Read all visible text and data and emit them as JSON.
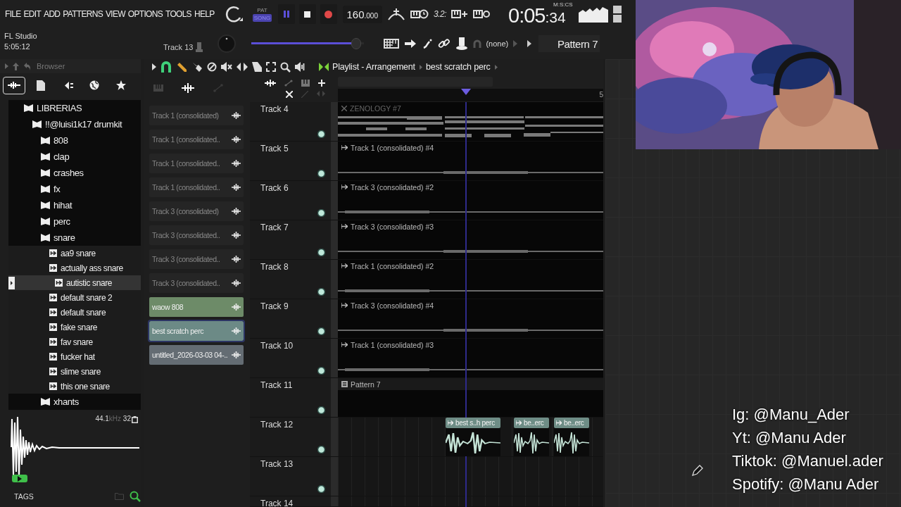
{
  "menu": [
    "FILE",
    "EDIT",
    "ADD",
    "PATTERNS",
    "VIEW",
    "OPTIONS",
    "TOOLS",
    "HELP"
  ],
  "mode_toggle": [
    {
      "label": "PAT",
      "selected": false
    },
    {
      "label": "SONG",
      "selected": true
    }
  ],
  "tempo": {
    "whole": "160",
    "fraction": ".000"
  },
  "snap_label": "3.2:",
  "time": {
    "main": "0:05",
    "sub": ":34",
    "unit": "M:S:CS"
  },
  "hint": {
    "app": "FL Studio",
    "time": "5:05:12"
  },
  "current_channel": "Track 13",
  "main_volume": {
    "level": 0.93
  },
  "mixer_target": "(none)",
  "pattern_name": "Pattern 7",
  "browser": {
    "title": "Browser",
    "tabs": [
      {
        "kind": "all",
        "selected": true
      },
      {
        "kind": "files",
        "selected": false
      },
      {
        "kind": "plugins",
        "selected": false
      },
      {
        "kind": "web",
        "selected": false
      },
      {
        "kind": "starred",
        "selected": false
      }
    ],
    "tree": [
      {
        "kind": "folder",
        "label": "LIBRERIAS",
        "selected": false,
        "children": [
          {
            "kind": "folder",
            "label": "!!@luisi1k17 drumkit",
            "selected": false,
            "children": [
              {
                "kind": "folder",
                "label": "808",
                "selected": false
              },
              {
                "kind": "folder",
                "label": "clap",
                "selected": false
              },
              {
                "kind": "folder",
                "label": "crashes",
                "selected": false
              },
              {
                "kind": "folder",
                "label": "fx",
                "selected": false
              },
              {
                "kind": "folder",
                "label": "hihat",
                "selected": false
              },
              {
                "kind": "folder",
                "label": "perc",
                "selected": false
              },
              {
                "kind": "folder",
                "label": "snare",
                "selected": false,
                "children": [
                  {
                    "kind": "file",
                    "label": "aa9 snare",
                    "selected": false
                  },
                  {
                    "kind": "file",
                    "label": "actually ass snare",
                    "selected": false
                  },
                  {
                    "kind": "file",
                    "label": "autistic snare",
                    "selected": true
                  },
                  {
                    "kind": "file",
                    "label": "default snare 2",
                    "selected": false
                  },
                  {
                    "kind": "file",
                    "label": "default snare",
                    "selected": false
                  },
                  {
                    "kind": "file",
                    "label": "fake snare",
                    "selected": false
                  },
                  {
                    "kind": "file",
                    "label": "fav snare",
                    "selected": false
                  },
                  {
                    "kind": "file",
                    "label": "fucker hat",
                    "selected": false
                  },
                  {
                    "kind": "file",
                    "label": "slime snare",
                    "selected": false
                  },
                  {
                    "kind": "file",
                    "label": "this one snare",
                    "selected": false
                  }
                ]
              },
              {
                "kind": "folder",
                "label": "xhants",
                "selected": false
              }
            ]
          }
        ]
      }
    ],
    "preview": {
      "rate": "44.1",
      "rate_unit": "kHz",
      "bits": "32"
    },
    "tags_label": "TAGS"
  },
  "playlist": {
    "title": "Playlist - Arrangement",
    "current": "best scratch perc",
    "picker": [
      {
        "label": "Track 1 (consolidated)",
        "color": "#252525",
        "selected": false
      },
      {
        "label": "Track 1 (consolidated..",
        "color": "#252525",
        "selected": false
      },
      {
        "label": "Track 1 (consolidated..",
        "color": "#252525",
        "selected": false
      },
      {
        "label": "Track 1 (consolidated..",
        "color": "#252525",
        "selected": false
      },
      {
        "label": "Track 3 (consolidated)",
        "color": "#252525",
        "selected": false
      },
      {
        "label": "Track 3 (consolidated..",
        "color": "#252525",
        "selected": false
      },
      {
        "label": "Track 3 (consolidated..",
        "color": "#252525",
        "selected": false
      },
      {
        "label": "Track 3 (consolidated..",
        "color": "#252525",
        "selected": false
      },
      {
        "label": "waow 808",
        "color": "#6d8b68",
        "selected": false
      },
      {
        "label": "best scratch perc",
        "color": "#6c8a86",
        "selected": true
      },
      {
        "label": "untitled_2026-03-03 04-..",
        "color": "#646c73",
        "selected": false
      }
    ],
    "ruler": [
      "5"
    ],
    "tracks": [
      {
        "name": "Track 4",
        "clips": [
          {
            "kind": "notes",
            "label": "ZENOLOGY #7"
          }
        ]
      },
      {
        "name": "Track 5",
        "clips": [
          {
            "kind": "audio",
            "label": "Track 1 (consolidated) #4"
          }
        ]
      },
      {
        "name": "Track 6",
        "clips": [
          {
            "kind": "audio",
            "label": "Track 3 (consolidated) #2"
          }
        ]
      },
      {
        "name": "Track 7",
        "clips": [
          {
            "kind": "audio",
            "label": "Track 3 (consolidated) #3"
          }
        ]
      },
      {
        "name": "Track 8",
        "clips": [
          {
            "kind": "audio",
            "label": "Track 1 (consolidated) #2"
          }
        ]
      },
      {
        "name": "Track 9",
        "clips": [
          {
            "kind": "audio",
            "label": "Track 3 (consolidated) #4"
          }
        ]
      },
      {
        "name": "Track 10",
        "clips": [
          {
            "kind": "audio",
            "label": "Track 1 (consolidated) #3"
          }
        ]
      },
      {
        "name": "Track 11",
        "clips": [
          {
            "kind": "pattern",
            "label": "Pattern 7"
          }
        ]
      },
      {
        "name": "Track 12",
        "clips": [
          {
            "kind": "sample",
            "label": "best s..h perc"
          },
          {
            "kind": "sample",
            "label": "be..erc"
          },
          {
            "kind": "sample",
            "label": "be..erc"
          }
        ]
      },
      {
        "name": "Track 13"
      },
      {
        "name": "Track 14"
      }
    ]
  },
  "social": [
    "Ig: @Manu_Ader",
    "Yt: @Manu Ader",
    "Tiktok: @Manuel.ader",
    "Spotify: @Manu Ader"
  ]
}
